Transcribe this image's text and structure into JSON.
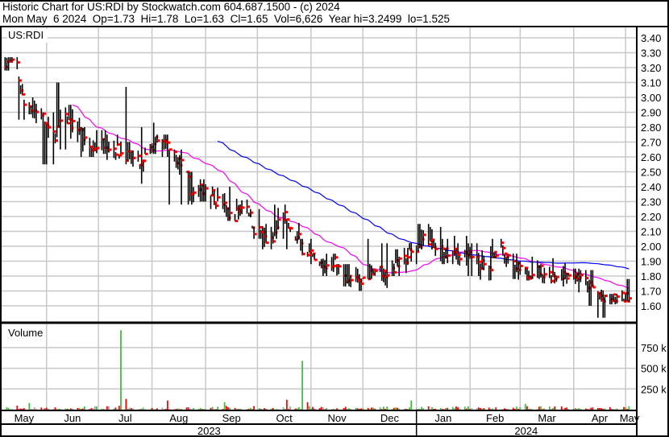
{
  "header": {
    "title": "Historic Chart for US:RDI by Stockwatch.com 604.687.1500 - (c) 2024",
    "quote": "Mon May  6 2024  Op=1.73  Hi=1.78  Lo=1.63  Cl=1.65  Vol=6,626  Year hi=3.2499  lo=1.525"
  },
  "chart_data": {
    "type": "ohlc",
    "symbol_label": "US:RDI",
    "volume_label": "Volume",
    "date_range": [
      "2023-05-06",
      "2024-05-07"
    ],
    "ylim": [
      1.5,
      3.47
    ],
    "price_ticks": [
      "3.40",
      "3.30",
      "3.20",
      "3.10",
      "3.00",
      "2.90",
      "2.80",
      "2.70",
      "2.60",
      "2.50",
      "2.40",
      "2.30",
      "2.20",
      "2.10",
      "2.00",
      "1.90",
      "1.80",
      "1.70",
      "1.60"
    ],
    "volume_ylim": [
      0,
      1000000
    ],
    "volume_ticks": [
      {
        "value": 750000,
        "label": "750 k"
      },
      {
        "value": 500000,
        "label": "500 k"
      },
      {
        "value": 250000,
        "label": "250 k"
      }
    ],
    "months": [
      {
        "label": "May",
        "date": "2023-05-01"
      },
      {
        "label": "Jun",
        "date": "2023-06-01"
      },
      {
        "label": "Jul",
        "date": "2023-07-01"
      },
      {
        "label": "Aug",
        "date": "2023-08-01"
      },
      {
        "label": "Sep",
        "date": "2023-09-01"
      },
      {
        "label": "Oct",
        "date": "2023-10-01"
      },
      {
        "label": "Nov",
        "date": "2023-11-01"
      },
      {
        "label": "Dec",
        "date": "2023-12-01"
      },
      {
        "label": "Jan",
        "date": "2024-01-01"
      },
      {
        "label": "Feb",
        "date": "2024-02-01"
      },
      {
        "label": "Mar",
        "date": "2024-03-01"
      },
      {
        "label": "Apr",
        "date": "2024-04-01"
      },
      {
        "label": "May",
        "date": "2024-05-01"
      }
    ],
    "years": [
      {
        "label": "2023",
        "from": "2023-05-06",
        "to": "2024-01-01"
      },
      {
        "label": "2024",
        "from": "2024-01-01",
        "to": "2024-05-07"
      }
    ],
    "weekly": {
      "close": [
        3.22,
        2.95,
        2.9,
        2.75,
        2.85,
        2.8,
        2.65,
        2.7,
        2.65,
        2.6,
        2.55,
        2.7,
        2.68,
        2.55,
        2.35,
        2.4,
        2.3,
        2.2,
        2.28,
        2.1,
        2.03,
        2.2,
        2.05,
        1.95,
        1.85,
        1.9,
        1.78,
        1.75,
        1.85,
        1.82,
        1.88,
        1.95,
        2.05,
        1.98,
        1.95,
        1.95,
        1.9,
        1.85,
        2.02,
        1.85,
        1.82,
        1.84,
        1.8,
        1.82,
        1.8,
        1.72,
        1.63,
        1.65,
        1.65
      ],
      "high": [
        3.27,
        3.15,
        3.0,
        2.9,
        3.1,
        2.95,
        2.8,
        2.78,
        2.75,
        3.07,
        2.8,
        2.83,
        2.75,
        2.65,
        2.5,
        2.45,
        2.58,
        2.4,
        2.35,
        2.25,
        2.15,
        2.28,
        2.18,
        2.05,
        1.95,
        1.95,
        1.88,
        2.05,
        2.05,
        2.02,
        1.98,
        2.05,
        2.15,
        2.13,
        2.05,
        2.07,
        2.02,
        2.0,
        2.05,
        1.95,
        1.9,
        1.93,
        1.92,
        1.9,
        1.85,
        1.84,
        1.73,
        1.68,
        1.78
      ],
      "low": [
        3.05,
        2.85,
        2.8,
        2.55,
        2.65,
        2.7,
        2.6,
        2.62,
        2.58,
        2.55,
        2.42,
        2.62,
        2.6,
        2.28,
        2.28,
        2.3,
        2.25,
        2.17,
        2.18,
        2.05,
        1.98,
        2.05,
        1.98,
        1.88,
        1.8,
        1.8,
        1.73,
        1.7,
        1.78,
        1.72,
        1.8,
        1.82,
        1.88,
        1.9,
        1.88,
        1.87,
        1.8,
        1.77,
        1.92,
        1.78,
        1.77,
        1.78,
        1.75,
        1.73,
        1.69,
        1.6,
        1.52,
        1.61,
        1.63
      ]
    },
    "volume_spikes": [
      {
        "date": "2023-05-22",
        "value": 80000,
        "dir": "up"
      },
      {
        "date": "2023-07-14",
        "value": 960000,
        "dir": "up"
      },
      {
        "date": "2023-07-17",
        "value": 130000,
        "dir": "down"
      },
      {
        "date": "2023-08-10",
        "value": 110000,
        "dir": "down"
      },
      {
        "date": "2023-09-12",
        "value": 90000,
        "dir": "up"
      },
      {
        "date": "2023-10-18",
        "value": 120000,
        "dir": "down"
      },
      {
        "date": "2023-10-27",
        "value": 590000,
        "dir": "up"
      },
      {
        "date": "2023-10-30",
        "value": 90000,
        "dir": "down"
      },
      {
        "date": "2023-12-29",
        "value": 110000,
        "dir": "up"
      },
      {
        "date": "2024-03-04",
        "value": 70000,
        "dir": "up"
      }
    ],
    "moving_averages": [
      {
        "period": 30,
        "color": "#ff00ff"
      },
      {
        "period": 90,
        "color": "#0000ff"
      }
    ],
    "colors": {
      "bar": "#000000",
      "close_tick": "#ff0000",
      "up": "#40c040",
      "down": "#ff0000",
      "flat": "#a0a0a0",
      "grid": "#c8c8c8"
    }
  }
}
